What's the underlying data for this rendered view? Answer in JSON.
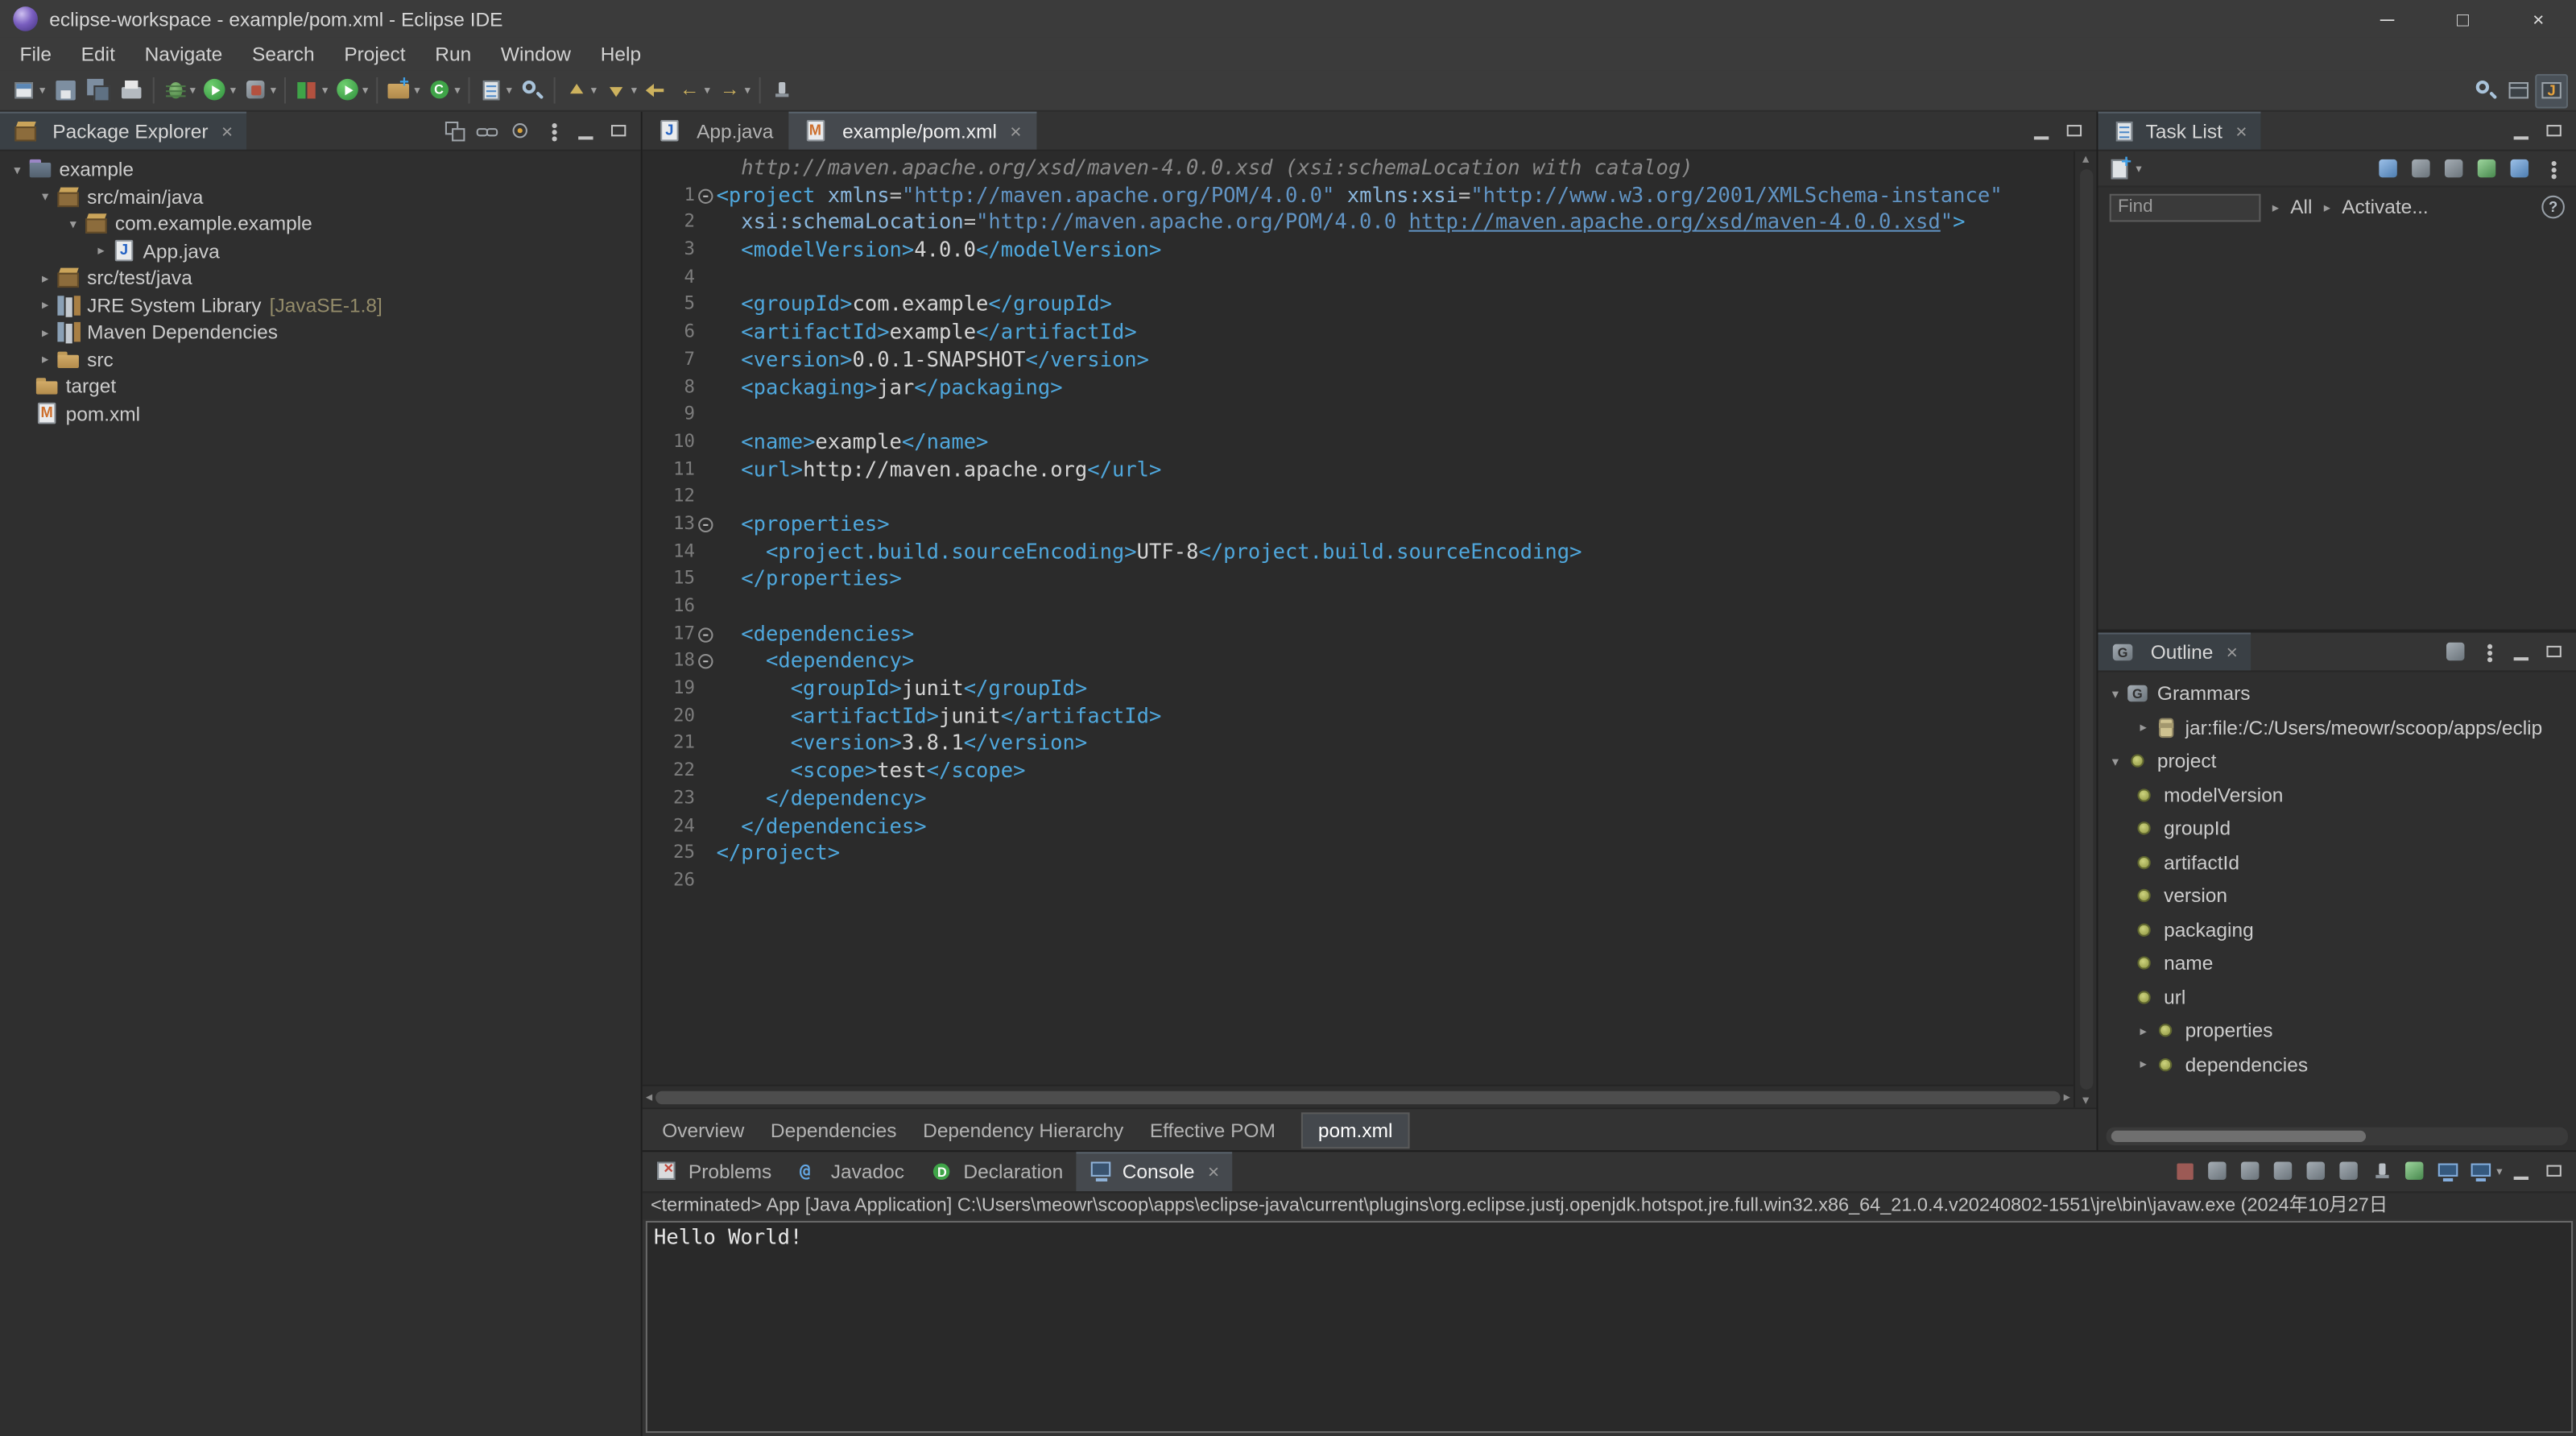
{
  "window": {
    "title": "eclipse-workspace - example/pom.xml - Eclipse IDE",
    "controls": {
      "minimize": "─",
      "maximize": "□",
      "close": "×"
    }
  },
  "menubar": [
    "File",
    "Edit",
    "Navigate",
    "Search",
    "Project",
    "Run",
    "Window",
    "Help"
  ],
  "toolbar": {
    "groups": [
      [
        {
          "name": "new-wizard",
          "icon": "new",
          "dd": true
        },
        {
          "name": "save",
          "icon": "save"
        },
        {
          "name": "save-all",
          "icon": "saveall"
        },
        {
          "name": "print",
          "icon": "print"
        }
      ],
      [
        {
          "name": "debug",
          "icon": "bug",
          "dd": true
        },
        {
          "name": "run",
          "icon": "run",
          "dd": true
        },
        {
          "name": "run-external-tools",
          "icon": "tool",
          "dd": true
        }
      ],
      [
        {
          "name": "coverage",
          "icon": "cov",
          "dd": true
        },
        {
          "name": "run-last-launched",
          "icon": "runlast",
          "dd": true
        }
      ],
      [
        {
          "name": "new-java-project",
          "icon": "newprj",
          "dd": true
        },
        {
          "name": "new-java-class",
          "icon": "newclass",
          "dd": true
        }
      ],
      [
        {
          "name": "open-task",
          "icon": "task",
          "dd": true
        },
        {
          "name": "search",
          "icon": "mag"
        }
      ],
      [
        {
          "name": "previous-annotation",
          "icon": "annotprev",
          "dd": true
        },
        {
          "name": "next-annotation",
          "icon": "annotnext",
          "dd": true
        },
        {
          "name": "last-edit-location",
          "icon": "editloc"
        },
        {
          "name": "back",
          "icon": "back",
          "dd": true
        },
        {
          "name": "forward",
          "icon": "fwd",
          "dd": true
        }
      ],
      [
        {
          "name": "pin-editor",
          "icon": "pin"
        }
      ]
    ],
    "right": [
      {
        "name": "quick-search",
        "icon": "mag"
      },
      {
        "name": "open-perspective",
        "icon": "persp"
      },
      {
        "name": "java-perspective",
        "icon": "perspj",
        "active": true
      }
    ]
  },
  "package_explorer": {
    "title": "Package Explorer",
    "header_icons": [
      {
        "name": "collapse-all",
        "icon": "collapse"
      },
      {
        "name": "link-with-editor",
        "icon": "link"
      },
      {
        "name": "focus-on-active-task",
        "icon": "focus"
      },
      {
        "name": "view-menu",
        "icon": "kebab"
      },
      {
        "name": "minimize-view",
        "icon": "min"
      },
      {
        "name": "maximize-view",
        "icon": "max"
      }
    ],
    "items": [
      {
        "label": "example",
        "indent": 0,
        "exp": "open",
        "icon": "project"
      },
      {
        "label": "src/main/java",
        "indent": 1,
        "exp": "open",
        "icon": "pkgfolder"
      },
      {
        "label": "com.example.example",
        "indent": 2,
        "exp": "open",
        "icon": "package"
      },
      {
        "label": "App.java",
        "indent": 3,
        "exp": "closed",
        "icon": "jfile"
      },
      {
        "label": "src/test/java",
        "indent": 1,
        "exp": "closed",
        "icon": "pkgfolder"
      },
      {
        "label": "JRE System Library",
        "suffix": "[JavaSE-1.8]",
        "indent": 1,
        "exp": "closed",
        "icon": "library"
      },
      {
        "label": "Maven Dependencies",
        "indent": 1,
        "exp": "closed",
        "icon": "library"
      },
      {
        "label": "src",
        "indent": 1,
        "exp": "closed",
        "icon": "folder"
      },
      {
        "label": "target",
        "indent": 1,
        "exp": "none",
        "icon": "folder"
      },
      {
        "label": "pom.xml",
        "indent": 1,
        "exp": "none",
        "icon": "mfile"
      }
    ]
  },
  "editor": {
    "tabs": [
      {
        "label": "App.java",
        "icon": "jfile",
        "active": false
      },
      {
        "label": "example/pom.xml",
        "icon": "mfile",
        "active": true
      }
    ],
    "header_icons": [
      {
        "name": "minimize-view",
        "icon": "min"
      },
      {
        "name": "maximize-view",
        "icon": "max"
      }
    ],
    "note": "http://maven.apache.org/xsd/maven-4.0.0.xsd (xsi:schemaLocation with catalog)",
    "lines": [
      {
        "n": 1,
        "fold": true,
        "segs": [
          [
            "tag",
            "<project"
          ],
          [
            "pln",
            " "
          ],
          [
            "attr",
            "xmlns"
          ],
          [
            "pln",
            "="
          ],
          [
            "val",
            "\"http://maven.apache.org/POM/4.0.0\""
          ],
          [
            "pln",
            " "
          ],
          [
            "attr",
            "xmlns:xsi"
          ],
          [
            "pln",
            "="
          ],
          [
            "val",
            "\"http://www.w3.org/2001/XMLSchema-instance\""
          ]
        ]
      },
      {
        "n": 2,
        "segs": [
          [
            "pln",
            "  "
          ],
          [
            "attr",
            "xsi:schemaLocation"
          ],
          [
            "pln",
            "="
          ],
          [
            "val",
            "\"http://maven.apache.org/POM/4.0.0 "
          ],
          [
            "lnk",
            "http://maven.apache.org/xsd/maven-4.0.0.xsd"
          ],
          [
            "val",
            "\""
          ],
          [
            "tag",
            ">"
          ]
        ]
      },
      {
        "n": 3,
        "segs": [
          [
            "pln",
            "  "
          ],
          [
            "tag",
            "<modelVersion>"
          ],
          [
            "txt",
            "4.0.0"
          ],
          [
            "tag",
            "</modelVersion>"
          ]
        ]
      },
      {
        "n": 4,
        "segs": []
      },
      {
        "n": 5,
        "segs": [
          [
            "pln",
            "  "
          ],
          [
            "tag",
            "<groupId>"
          ],
          [
            "txt",
            "com.example"
          ],
          [
            "tag",
            "</groupId>"
          ]
        ]
      },
      {
        "n": 6,
        "segs": [
          [
            "pln",
            "  "
          ],
          [
            "tag",
            "<artifactId>"
          ],
          [
            "txt",
            "example"
          ],
          [
            "tag",
            "</artifactId>"
          ]
        ]
      },
      {
        "n": 7,
        "segs": [
          [
            "pln",
            "  "
          ],
          [
            "tag",
            "<version>"
          ],
          [
            "txt",
            "0.0.1-SNAPSHOT"
          ],
          [
            "tag",
            "</version>"
          ]
        ]
      },
      {
        "n": 8,
        "segs": [
          [
            "pln",
            "  "
          ],
          [
            "tag",
            "<packaging>"
          ],
          [
            "txt",
            "jar"
          ],
          [
            "tag",
            "</packaging>"
          ]
        ]
      },
      {
        "n": 9,
        "segs": []
      },
      {
        "n": 10,
        "segs": [
          [
            "pln",
            "  "
          ],
          [
            "tag",
            "<name>"
          ],
          [
            "txt",
            "example"
          ],
          [
            "tag",
            "</name>"
          ]
        ]
      },
      {
        "n": 11,
        "segs": [
          [
            "pln",
            "  "
          ],
          [
            "tag",
            "<url>"
          ],
          [
            "txt",
            "http://maven.apache.org"
          ],
          [
            "tag",
            "</url>"
          ]
        ]
      },
      {
        "n": 12,
        "segs": []
      },
      {
        "n": 13,
        "fold": true,
        "segs": [
          [
            "pln",
            "  "
          ],
          [
            "tag",
            "<properties>"
          ]
        ]
      },
      {
        "n": 14,
        "segs": [
          [
            "pln",
            "    "
          ],
          [
            "tag",
            "<project.build.sourceEncoding>"
          ],
          [
            "txt",
            "UTF-8"
          ],
          [
            "tag",
            "</project.build.sourceEncoding>"
          ]
        ]
      },
      {
        "n": 15,
        "segs": [
          [
            "pln",
            "  "
          ],
          [
            "tag",
            "</properties>"
          ]
        ]
      },
      {
        "n": 16,
        "segs": []
      },
      {
        "n": 17,
        "fold": true,
        "segs": [
          [
            "pln",
            "  "
          ],
          [
            "tag",
            "<dependencies>"
          ]
        ]
      },
      {
        "n": 18,
        "fold": true,
        "segs": [
          [
            "pln",
            "    "
          ],
          [
            "tag",
            "<dependency>"
          ]
        ]
      },
      {
        "n": 19,
        "segs": [
          [
            "pln",
            "      "
          ],
          [
            "tag",
            "<groupId>"
          ],
          [
            "txt",
            "junit"
          ],
          [
            "tag",
            "</groupId>"
          ]
        ]
      },
      {
        "n": 20,
        "segs": [
          [
            "pln",
            "      "
          ],
          [
            "tag",
            "<artifactId>"
          ],
          [
            "txt",
            "junit"
          ],
          [
            "tag",
            "</artifactId>"
          ]
        ]
      },
      {
        "n": 21,
        "segs": [
          [
            "pln",
            "      "
          ],
          [
            "tag",
            "<version>"
          ],
          [
            "txt",
            "3.8.1"
          ],
          [
            "tag",
            "</version>"
          ]
        ]
      },
      {
        "n": 22,
        "segs": [
          [
            "pln",
            "      "
          ],
          [
            "tag",
            "<scope>"
          ],
          [
            "txt",
            "test"
          ],
          [
            "tag",
            "</scope>"
          ]
        ]
      },
      {
        "n": 23,
        "segs": [
          [
            "pln",
            "    "
          ],
          [
            "tag",
            "</dependency>"
          ]
        ]
      },
      {
        "n": 24,
        "segs": [
          [
            "pln",
            "  "
          ],
          [
            "tag",
            "</dependencies>"
          ]
        ]
      },
      {
        "n": 25,
        "segs": [
          [
            "tag",
            "</project>"
          ]
        ]
      },
      {
        "n": 26,
        "segs": []
      }
    ],
    "bottom_tabs": [
      {
        "label": "Overview"
      },
      {
        "label": "Dependencies"
      },
      {
        "label": "Dependency Hierarchy"
      },
      {
        "label": "Effective POM"
      },
      {
        "label": "pom.xml",
        "active": true
      }
    ]
  },
  "task_list": {
    "title": "Task List",
    "header_icons": [
      {
        "name": "minimize-view",
        "icon": "min"
      },
      {
        "name": "maximize-view",
        "icon": "max"
      }
    ],
    "toolbar": [
      {
        "name": "new-task",
        "icon": "newtask",
        "dd": true
      }
    ],
    "toolbar_right": [
      {
        "name": "categorized",
        "icon": "gi-blue"
      },
      {
        "name": "scheduled-presentation",
        "icon": "gi"
      },
      {
        "name": "focus-on-workweek",
        "icon": "gi"
      },
      {
        "name": "synchronize",
        "icon": "gi-green"
      },
      {
        "name": "task-filters",
        "icon": "gi-blue"
      },
      {
        "name": "view-menu",
        "icon": "kebab"
      }
    ],
    "find_placeholder": "Find",
    "scope_all": "All",
    "activate": "Activate...",
    "help": "?"
  },
  "outline": {
    "title": "Outline",
    "header_icons": [
      {
        "name": "sort",
        "icon": "gi"
      },
      {
        "name": "view-menu",
        "icon": "kebab"
      },
      {
        "name": "minimize-view",
        "icon": "min"
      },
      {
        "name": "maximize-view",
        "icon": "max"
      }
    ],
    "items": [
      {
        "label": "Grammars",
        "indent": 0,
        "exp": "open",
        "icon": "grammars"
      },
      {
        "label": "jar:file:/C:/Users/meowr/scoop/apps/eclip",
        "indent": 1,
        "exp": "closed",
        "icon": "jar"
      },
      {
        "label": "project",
        "indent": 0,
        "exp": "open",
        "icon": "element"
      },
      {
        "label": "modelVersion",
        "indent": 1,
        "exp": "none",
        "icon": "element"
      },
      {
        "label": "groupId",
        "indent": 1,
        "exp": "none",
        "icon": "element"
      },
      {
        "label": "artifactId",
        "indent": 1,
        "exp": "none",
        "icon": "element"
      },
      {
        "label": "version",
        "indent": 1,
        "exp": "none",
        "icon": "element"
      },
      {
        "label": "packaging",
        "indent": 1,
        "exp": "none",
        "icon": "element"
      },
      {
        "label": "name",
        "indent": 1,
        "exp": "none",
        "icon": "element"
      },
      {
        "label": "url",
        "indent": 1,
        "exp": "none",
        "icon": "element"
      },
      {
        "label": "properties",
        "indent": 1,
        "exp": "closed",
        "icon": "element"
      },
      {
        "label": "dependencies",
        "indent": 1,
        "exp": "closed",
        "icon": "element"
      }
    ]
  },
  "console": {
    "tabs": [
      {
        "label": "Problems",
        "icon": "problems"
      },
      {
        "label": "Javadoc",
        "icon": "javadoc"
      },
      {
        "label": "Declaration",
        "icon": "declaration"
      },
      {
        "label": "Console",
        "icon": "console",
        "active": true
      }
    ],
    "toolbar": [
      {
        "name": "terminate",
        "icon": "term"
      },
      {
        "name": "remove-launch",
        "icon": "gi"
      },
      {
        "name": "remove-all-terminated",
        "icon": "gi"
      },
      {
        "name": "clear-console",
        "icon": "gi"
      },
      {
        "name": "scroll-lock",
        "icon": "gi"
      },
      {
        "name": "word-wrap",
        "icon": "gi"
      },
      {
        "name": "pin-console",
        "icon": "pin"
      },
      {
        "name": "show-console-on-output",
        "icon": "gi-green"
      },
      {
        "name": "display-selected-console",
        "icon": "mon"
      },
      {
        "name": "open-console",
        "icon": "mon",
        "dd": true
      },
      {
        "name": "minimize-view",
        "icon": "min"
      },
      {
        "name": "maximize-view",
        "icon": "max"
      }
    ],
    "status": "<terminated> App [Java Application] C:\\Users\\meowr\\scoop\\apps\\eclipse-java\\current\\plugins\\org.eclipse.justj.openjdk.hotspot.jre.full.win32.x86_64_21.0.4.v20240802-1551\\jre\\bin\\javaw.exe (2024年10月27日",
    "output": "Hello World!"
  }
}
